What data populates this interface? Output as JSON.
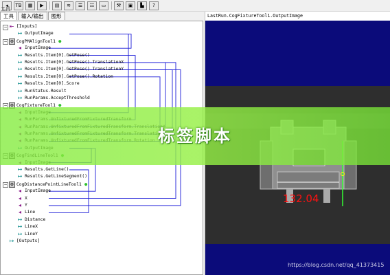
{
  "toolbar": {
    "buttons": [
      {
        "id": "arrow",
        "glyph": "◂"
      },
      {
        "id": "tb",
        "glyph": "TB"
      },
      {
        "id": "grid",
        "glyph": "▦"
      },
      {
        "id": "run",
        "glyph": "▶"
      },
      {
        "id": "open",
        "glyph": "▤"
      },
      {
        "id": "stack",
        "glyph": "≋"
      },
      {
        "id": "list1",
        "glyph": "☰"
      },
      {
        "id": "list2",
        "glyph": "☷"
      },
      {
        "id": "save",
        "glyph": "▭"
      },
      {
        "id": "tools",
        "glyph": "⚒"
      },
      {
        "id": "img",
        "glyph": "▣"
      },
      {
        "id": "chart",
        "glyph": "▙"
      },
      {
        "id": "help",
        "glyph": "?"
      }
    ],
    "caption": "工具"
  },
  "tabs": [
    "工具",
    "输入/输出",
    "图形"
  ],
  "tree": [
    {
      "label": "[Inputs]",
      "indent": 0,
      "kind": "group"
    },
    {
      "label": "OutputImage",
      "indent": 2,
      "kind": "out"
    },
    {
      "label": "CogPMAlignTool1",
      "indent": 0,
      "kind": "tool",
      "ok": true
    },
    {
      "label": "InputImage",
      "indent": 2,
      "kind": "in"
    },
    {
      "label": "Results.Item[0].GetPose()",
      "indent": 2,
      "kind": "out"
    },
    {
      "label": "Results.Item[0].GetPose().TranslationX",
      "indent": 2,
      "kind": "out"
    },
    {
      "label": "Results.Item[0].GetPose().TranslationY",
      "indent": 2,
      "kind": "out"
    },
    {
      "label": "Results.Item[0].GetPose().Rotation",
      "indent": 2,
      "kind": "out"
    },
    {
      "label": "Results.Item[0].Score",
      "indent": 2,
      "kind": "out"
    },
    {
      "label": "RunStatus.Result",
      "indent": 2,
      "kind": "out"
    },
    {
      "label": "RunParams.AcceptThreshold",
      "indent": 2,
      "kind": "out"
    },
    {
      "label": "CogFixtureTool1",
      "indent": 0,
      "kind": "tool",
      "ok": true
    },
    {
      "label": "InputImage",
      "indent": 2,
      "kind": "in"
    },
    {
      "label": "RunParams.UnfixturedFromFixturedTransform",
      "indent": 2,
      "kind": "in"
    },
    {
      "label": "RunParams.UnfixturedFromFixturedTransform.TranslationX",
      "indent": 2,
      "kind": "in"
    },
    {
      "label": "RunParams.UnfixturedFromFixturedTransform.TranslationY",
      "indent": 2,
      "kind": "in"
    },
    {
      "label": "RunParams.UnfixturedFromFixturedTransform.Rotation",
      "indent": 2,
      "kind": "in"
    },
    {
      "label": "OutputImage",
      "indent": 2,
      "kind": "out"
    },
    {
      "label": "CogFindLineTool1",
      "indent": 0,
      "kind": "tool",
      "ok": true
    },
    {
      "label": "InputImage",
      "indent": 2,
      "kind": "in"
    },
    {
      "label": "Results.GetLine()",
      "indent": 2,
      "kind": "out"
    },
    {
      "label": "Results.GetLineSegment()",
      "indent": 2,
      "kind": "out"
    },
    {
      "label": "CogDistancePointLineTool1",
      "indent": 0,
      "kind": "tool",
      "ok": true
    },
    {
      "label": "InputImage",
      "indent": 2,
      "kind": "in"
    },
    {
      "label": "X",
      "indent": 2,
      "kind": "in"
    },
    {
      "label": "Y",
      "indent": 2,
      "kind": "in"
    },
    {
      "label": "Line",
      "indent": 2,
      "kind": "in"
    },
    {
      "label": "Distance",
      "indent": 2,
      "kind": "out"
    },
    {
      "label": "LineX",
      "indent": 2,
      "kind": "out"
    },
    {
      "label": "LineY",
      "indent": 2,
      "kind": "out"
    },
    {
      "label": "[Outputs]",
      "indent": 0,
      "kind": "group-out"
    }
  ],
  "viewer": {
    "title": "LastRun.CogFixtureTool1.OutputImage",
    "measurement": "132.04",
    "watermark": "https://blog.csdn.net/qq_41373415"
  },
  "banner": {
    "text": "标签脚本"
  },
  "colors": {
    "link_blue": "#1a1ad8",
    "in_arrow": "#8b1a8b",
    "out_arrow": "#0a8a8a",
    "ok_dot": "#2fbf2f",
    "viewer_bg": "#0b0b7a",
    "measure_red": "#ff1010"
  }
}
